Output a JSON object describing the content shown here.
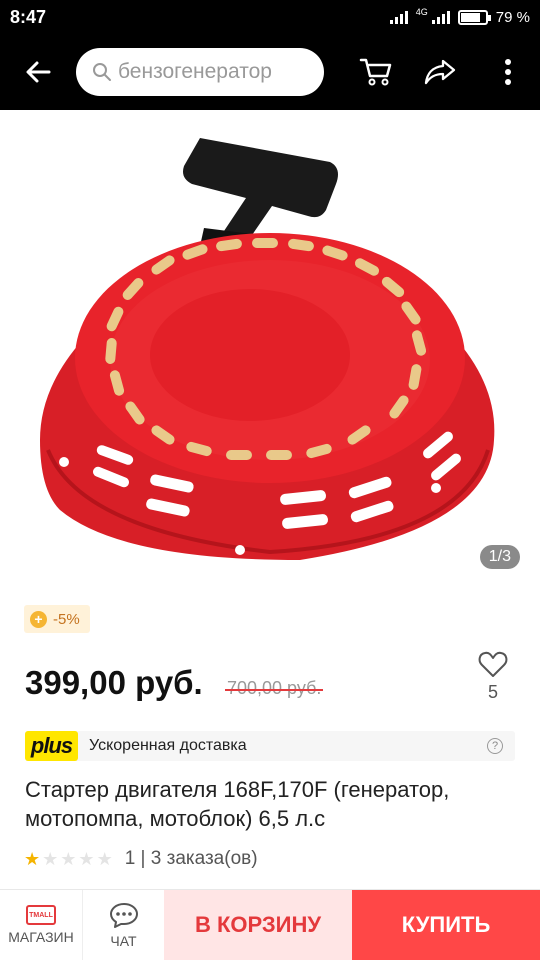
{
  "status_bar": {
    "time": "8:47",
    "network": "4G",
    "battery": "79 %"
  },
  "header": {
    "search_placeholder": "бензогенератор",
    "icons": [
      "back-arrow-icon",
      "search-icon",
      "cart-icon",
      "share-icon",
      "more-icon"
    ]
  },
  "gallery": {
    "counter": "1/3"
  },
  "product": {
    "discount": "-5%",
    "price": "399,00 руб.",
    "old_price": "700,00 руб.",
    "wishlist_count": "5",
    "delivery_label": "Ускоренная доставка",
    "plus_logo": "plus",
    "help_glyph": "?",
    "title": "Стартер двигателя 168F,170F (генератор, мотопомпа, мотоблок) 6,5 л.с",
    "rating_value": 1,
    "rating_max": 5,
    "orders": "1 | 3 заказа(ов)"
  },
  "bottom_bar": {
    "store_label": "МАГАЗИН",
    "store_logo": "TMALL",
    "chat_label": "ЧАТ",
    "cart_button": "В КОРЗИНУ",
    "buy_button": "КУПИТЬ"
  },
  "colors": {
    "accent": "#ff4747",
    "cart_bg": "#ffe5e5",
    "plus_yellow": "#ffe600",
    "product_red": "#e8232b"
  }
}
